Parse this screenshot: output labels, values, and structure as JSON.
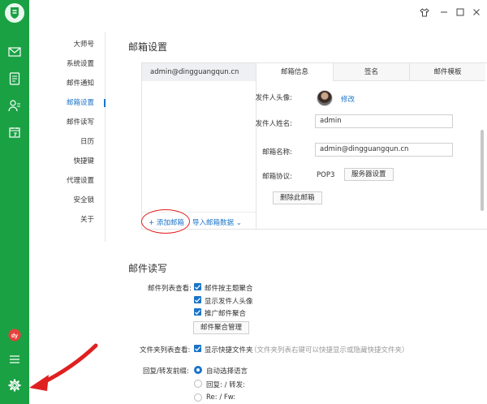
{
  "nav": {
    "items": [
      "大师号",
      "系统设置",
      "邮件通知",
      "邮箱设置",
      "邮件读写",
      "日历",
      "快捷键",
      "代理设置",
      "安全锁",
      "关于"
    ],
    "active_index": 3
  },
  "mailbox_settings": {
    "title": "邮箱设置",
    "accounts": [
      "admin@dingguangqun.cn"
    ],
    "add_label": "+ 添加邮箱",
    "import_label": "导入邮箱数据 ⌄",
    "tabs": [
      "邮箱信息",
      "签名",
      "邮件模板"
    ],
    "active_tab": 0,
    "avatar_label": "发件人头像:",
    "edit_label": "修改",
    "sender_name_label": "发件人姓名:",
    "sender_name_value": "admin",
    "mailbox_name_label": "邮箱名称:",
    "mailbox_name_value": "admin@dingguangqun.cn",
    "protocol_label": "邮箱协议:",
    "protocol_value": "POP3",
    "server_button": "服务器设置",
    "delete_button": "删除此邮箱"
  },
  "mail_rw": {
    "title": "邮件读写",
    "list_view_label": "邮件列表查看:",
    "list_options": [
      "邮件按主题聚合",
      "显示发件人头像",
      "推广邮件聚合"
    ],
    "aggregate_button": "邮件聚合管理",
    "folder_view_label": "文件夹列表查看:",
    "folder_option": "显示快捷文件夹",
    "folder_hint": "（文件夹列表右键可以快捷显示或隐藏快捷文件夹）",
    "reply_prefix_label": "回复/转发前缀:",
    "reply_options": [
      "自动选择语言",
      "回复: / 转发:",
      "Re: / Fw:"
    ],
    "reply_selected": 0
  },
  "colors": {
    "rail": "#1aa144",
    "accent": "#1a73c8",
    "annotation": "#e02020"
  },
  "icons": {
    "rail_top": [
      "mail-icon",
      "notebook-icon",
      "contacts-icon",
      "calendar-icon"
    ],
    "rail_bottom": [
      "dy-app-icon",
      "menu-icon",
      "gear-icon"
    ],
    "window": [
      "skin-icon",
      "minimize-icon",
      "maximize-icon",
      "close-icon"
    ]
  }
}
